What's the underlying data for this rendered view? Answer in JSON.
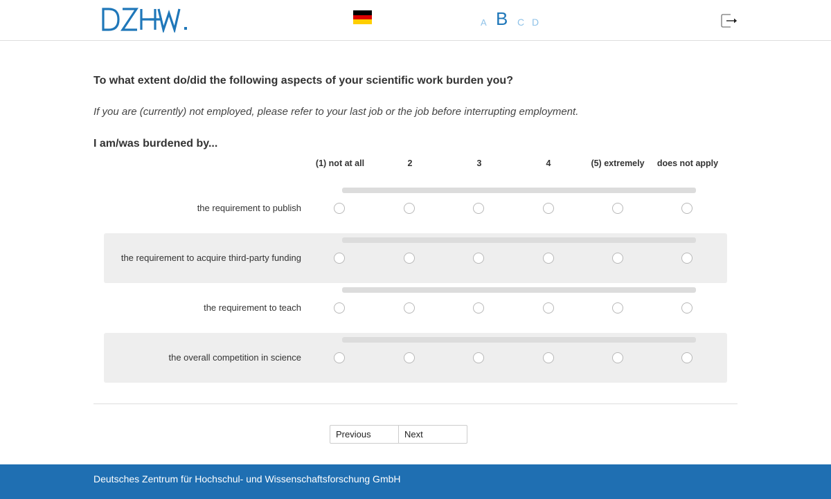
{
  "header": {
    "logo_text": "DZHW.",
    "language_flag": "germany-flag-icon",
    "font_sizes": [
      "A",
      "B",
      "C",
      "D"
    ],
    "exit_icon": "exit-icon",
    "colors": {
      "brand_blue": "#1f77b9",
      "light_blue": "#8fc2e8"
    }
  },
  "question": {
    "title": "To what extent do/did the following aspects of your scientific work burden you?",
    "instruction": "If you are (currently) not employed, please refer to your last job or the job before interrupting employment.",
    "subheading": "I am/was burdened by..."
  },
  "scale": {
    "columns": [
      "(1) not at all",
      "2",
      "3",
      "4",
      "(5) extremely",
      "does not apply"
    ]
  },
  "items": [
    {
      "label": "the requirement to publish",
      "selected": null
    },
    {
      "label": "the requirement to acquire third-party funding",
      "selected": null
    },
    {
      "label": "the requirement to teach",
      "selected": null
    },
    {
      "label": "the overall competition in science",
      "selected": null
    }
  ],
  "navigation": {
    "previous_label": "Previous",
    "next_label": "Next"
  },
  "footer": {
    "text": "Deutsches Zentrum für Hochschul- und Wissenschaftsforschung GmbH",
    "color": "#1f6fb2"
  }
}
